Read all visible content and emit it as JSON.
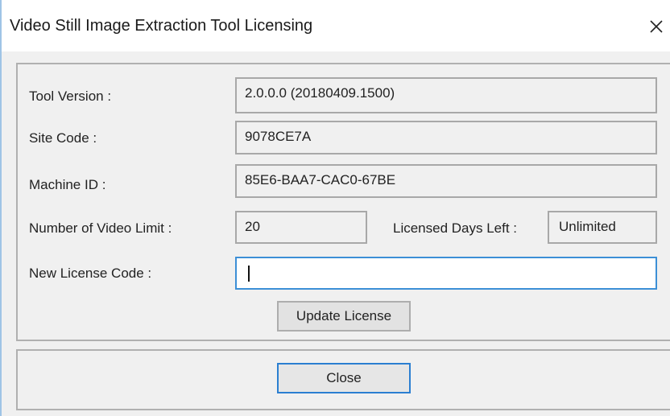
{
  "window": {
    "title": "Video Still Image Extraction Tool Licensing",
    "close_icon": "close-icon"
  },
  "form": {
    "tool_version_label": "Tool Version :",
    "tool_version_value": "2.0.0.0 (20180409.1500)",
    "site_code_label": "Site Code :",
    "site_code_value": "9078CE7A",
    "machine_id_label": "Machine ID :",
    "machine_id_value": "85E6-BAA7-CAC0-67BE",
    "video_limit_label": "Number of Video Limit :",
    "video_limit_value": "20",
    "days_left_label": "Licensed Days Left :",
    "days_left_value": "Unlimited",
    "new_license_label": "New License Code :",
    "new_license_value": ""
  },
  "buttons": {
    "update_label": "Update License",
    "close_label": "Close"
  },
  "colors": {
    "accent": "#3c8fd6",
    "window_border": "#9fc4e6",
    "client_bg": "#f0f0f0"
  }
}
